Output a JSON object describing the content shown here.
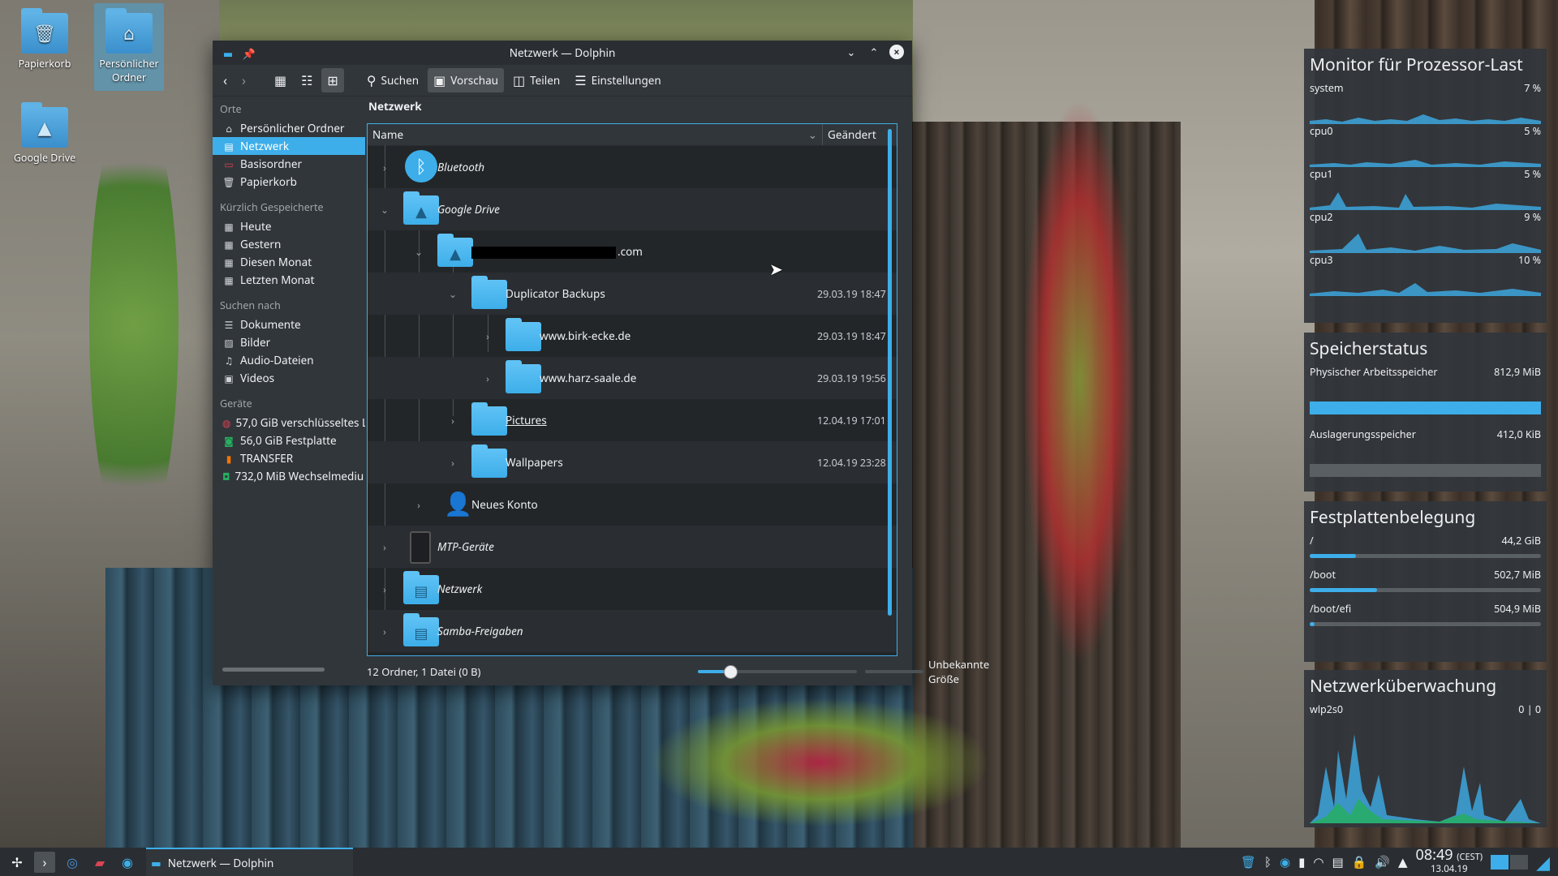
{
  "desktop": {
    "icons": [
      {
        "label": "Papierkorb"
      },
      {
        "label": "Persönlicher Ordner"
      },
      {
        "label": "Google Drive"
      }
    ]
  },
  "window": {
    "title": "Netzwerk — Dolphin",
    "toolbar": {
      "search": "Suchen",
      "preview": "Vorschau",
      "split": "Teilen",
      "settings": "Einstellungen"
    },
    "breadcrumb": "Netzwerk",
    "sidebar": {
      "places_header": "Orte",
      "places": [
        {
          "label": "Persönlicher Ordner",
          "icon": "home"
        },
        {
          "label": "Netzwerk",
          "icon": "network"
        },
        {
          "label": "Basisordner",
          "icon": "root-folder"
        },
        {
          "label": "Papierkorb",
          "icon": "trash"
        }
      ],
      "recent_header": "Kürzlich Gespeicherte",
      "recent": [
        {
          "label": "Heute"
        },
        {
          "label": "Gestern"
        },
        {
          "label": "Diesen Monat"
        },
        {
          "label": "Letzten Monat"
        }
      ],
      "search_header": "Suchen nach",
      "search": [
        {
          "label": "Dokumente",
          "icon": "document"
        },
        {
          "label": "Bilder",
          "icon": "image"
        },
        {
          "label": "Audio-Dateien",
          "icon": "music"
        },
        {
          "label": "Videos",
          "icon": "video"
        }
      ],
      "devices_header": "Geräte",
      "devices": [
        {
          "label": "57,0 GiB verschlüsseltes L"
        },
        {
          "label": "56,0 GiB Festplatte"
        },
        {
          "label": "TRANSFER"
        },
        {
          "label": "732,0 MiB Wechselmediu"
        }
      ]
    },
    "columns": {
      "name": "Name",
      "modified": "Geändert"
    },
    "rows": [
      {
        "label": "Bluetooth",
        "date": ""
      },
      {
        "label": "Google Drive",
        "date": ""
      },
      {
        "label": ".com",
        "date": ""
      },
      {
        "label": "Duplicator Backups",
        "date": "29.03.19 18:47"
      },
      {
        "label": "www.birk-ecke.de",
        "date": "29.03.19 18:47"
      },
      {
        "label": "www.harz-saale.de",
        "date": "29.03.19 19:56"
      },
      {
        "label": "Pictures",
        "date": "12.04.19 17:01"
      },
      {
        "label": "Wallpapers",
        "date": "12.04.19 23:28"
      },
      {
        "label": "Neues Konto",
        "date": ""
      },
      {
        "label": "MTP-Geräte",
        "date": ""
      },
      {
        "label": "Netzwerk",
        "date": ""
      },
      {
        "label": "Samba-Freigaben",
        "date": ""
      }
    ],
    "status": {
      "summary": "12 Ordner, 1 Datei (0 B)",
      "free": "Unbekannte Größe"
    }
  },
  "widgets": {
    "cpu": {
      "title": "Monitor für Prozessor-Last",
      "rows": [
        {
          "name": "system",
          "value": "7 %"
        },
        {
          "name": "cpu0",
          "value": "5 %"
        },
        {
          "name": "cpu1",
          "value": "5 %"
        },
        {
          "name": "cpu2",
          "value": "9 %"
        },
        {
          "name": "cpu3",
          "value": "10 %"
        }
      ]
    },
    "memory": {
      "title": "Speicherstatus",
      "rows": [
        {
          "name": "Physischer Arbeitsspeicher",
          "value": "812,9 MiB",
          "fill": 1.0
        },
        {
          "name": "Auslagerungsspeicher",
          "value": "412,0 KiB",
          "fill": 0.0
        }
      ]
    },
    "disk": {
      "title": "Festplattenbelegung",
      "rows": [
        {
          "name": "/",
          "value": "44,2 GiB",
          "fill": 0.2
        },
        {
          "name": "/boot",
          "value": "502,7 MiB",
          "fill": 0.29
        },
        {
          "name": "/boot/efi",
          "value": "504,9 MiB",
          "fill": 0.02
        }
      ]
    },
    "network": {
      "title": "Netzwerküberwachung",
      "iface": "wlp2s0",
      "value": "0 | 0"
    }
  },
  "taskbar": {
    "task_label": "Netzwerk — Dolphin",
    "time": "08:49",
    "tz": "(CEST)",
    "date": "13.04.19"
  },
  "colors": {
    "accent": "#3daee9",
    "panel": "#31363b",
    "view": "#232629"
  }
}
